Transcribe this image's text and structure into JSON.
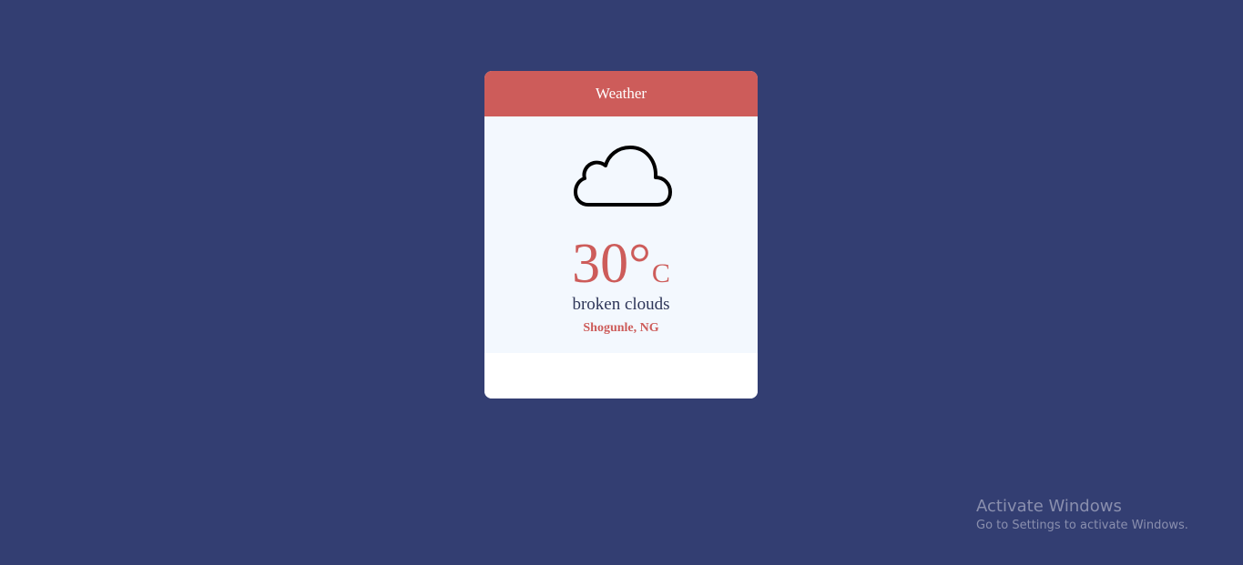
{
  "card": {
    "header_title": "Weather",
    "icon": "cloud-icon",
    "temperature": "30°",
    "temperature_unit": "C",
    "description": "broken clouds",
    "location": "Shogunle, NG"
  },
  "colors": {
    "background": "#333e72",
    "accent": "#cd5c5a",
    "card_body": "#f3f8fe",
    "text_dark": "#2e3658"
  },
  "watermark": {
    "title": "Activate Windows",
    "subtitle": "Go to Settings to activate Windows."
  }
}
